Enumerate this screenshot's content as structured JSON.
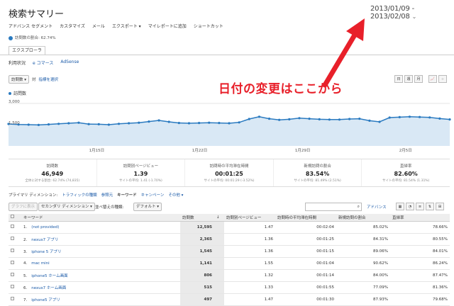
{
  "page": {
    "title": "検索サマリー",
    "date_range": "2013/01/09 - 2013/02/08"
  },
  "toolbar": [
    "アドバンス セグメント",
    "カスタマイズ",
    "メール",
    "エクスポート ▾",
    "マイレポートに追加",
    "ショートカット"
  ],
  "segment": {
    "label": "訪問数の割合: 62.74%"
  },
  "tab": "エクスプローラ",
  "subtabs": {
    "usage": "利用状況",
    "ecommerce": "e コマース",
    "adsense": "AdSense"
  },
  "metric": {
    "selected": "訪問数",
    "vs": "対",
    "vs_select": "指標を選択"
  },
  "view_buttons": [
    "日",
    "週",
    "月"
  ],
  "legend": "訪問数",
  "annotation": "日付の変更はここから",
  "chart_data": {
    "type": "area",
    "series": [
      {
        "name": "訪問数",
        "values": [
          1550,
          1510,
          1500,
          1480,
          1520,
          1560,
          1600,
          1640,
          1540,
          1530,
          1500,
          1560,
          1600,
          1640,
          1720,
          1800,
          1700,
          1620,
          1600,
          1620,
          1640,
          1620,
          1600,
          1660,
          1900,
          2060,
          1920,
          1840,
          1880,
          1960,
          1920,
          1880,
          1860,
          1860,
          1900,
          1920,
          1780,
          1700,
          2000,
          2030,
          2060,
          2040,
          2010,
          1930,
          1870
        ]
      }
    ],
    "ylim": [
      0,
      3000
    ],
    "ytick_labels": [
      "3,000",
      "1,500"
    ],
    "xtick_labels": [
      "1月15日",
      "1月22日",
      "1月29日",
      "2月5日"
    ]
  },
  "stats": [
    {
      "label": "訪問数",
      "value": "46,949",
      "sub": "全体に対する割合: 62.74% (74,835)"
    },
    {
      "label": "訪問別ページビュー",
      "value": "1.39",
      "sub": "サイトの平均: 1.41 (-1.70%)"
    },
    {
      "label": "訪問時の平均滞在時間",
      "value": "00:01:25",
      "sub": "サイトの平均: 00:01:29 (-3.52%)"
    },
    {
      "label": "新規訪問の割合",
      "value": "83.54%",
      "sub": "サイトの平均: 81.49% (2.51%)"
    },
    {
      "label": "直帰率",
      "value": "82.60%",
      "sub": "サイトの平均: 81.54% (1.31%)"
    }
  ],
  "dimension": {
    "label": "プライマリ ディメンション:",
    "items": [
      "トラフィックの種類",
      "参照元",
      "キーワード",
      "キャンペーン",
      "その他 ▾"
    ]
  },
  "controls": {
    "plot": "グラフに表示",
    "secondary": "セカンダリ ディメンション ▾",
    "sort": "並べ替えの種類:",
    "sort_val": "デフォルト ▾",
    "advanced": "アドバンス"
  },
  "table": {
    "headers": [
      "",
      "キーワード",
      "訪問数",
      "↓",
      "訪問別ページビュー",
      "訪問時の平均滞在時間",
      "新規訪問の割合",
      "直帰率"
    ],
    "rows": [
      [
        "1.",
        "(not provided)",
        "12,595",
        "1.47",
        "00:02:04",
        "85.02%",
        "78.66%"
      ],
      [
        "2.",
        "nexus7 アプリ",
        "2,365",
        "1.36",
        "00:01:25",
        "84.31%",
        "80.55%"
      ],
      [
        "3.",
        "iphone 5 アプリ",
        "1,545",
        "1.36",
        "00:01:15",
        "89.06%",
        "84.01%"
      ],
      [
        "4.",
        "mac mini",
        "1,141",
        "1.55",
        "00:01:04",
        "90.62%",
        "86.24%"
      ],
      [
        "5.",
        "iphone5 ホーム画面",
        "806",
        "1.32",
        "00:01:14",
        "84.00%",
        "87.47%"
      ],
      [
        "6.",
        "nexus7 ホーム画面",
        "515",
        "1.33",
        "00:01:55",
        "77.09%",
        "81.36%"
      ],
      [
        "7.",
        "iphone5 アプリ",
        "497",
        "1.47",
        "00:01:30",
        "87.93%",
        "79.68%"
      ]
    ]
  }
}
